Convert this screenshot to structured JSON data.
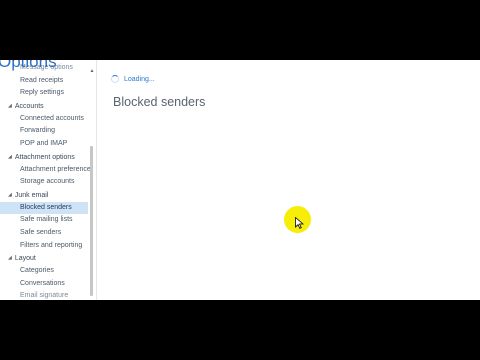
{
  "header": {
    "title": "Options"
  },
  "sidebar": {
    "items": [
      {
        "label": "Message options",
        "kind": "sub",
        "state": "cut"
      },
      {
        "label": "Read receipts",
        "kind": "sub"
      },
      {
        "label": "Reply settings",
        "kind": "sub"
      },
      {
        "label": "Accounts",
        "kind": "group"
      },
      {
        "label": "Connected accounts",
        "kind": "sub"
      },
      {
        "label": "Forwarding",
        "kind": "sub"
      },
      {
        "label": "POP and IMAP",
        "kind": "sub"
      },
      {
        "label": "Attachment options",
        "kind": "group"
      },
      {
        "label": "Attachment preference",
        "kind": "sub"
      },
      {
        "label": "Storage accounts",
        "kind": "sub"
      },
      {
        "label": "Junk email",
        "kind": "group"
      },
      {
        "label": "Blocked senders",
        "kind": "sub",
        "state": "selected"
      },
      {
        "label": "Safe mailing lists",
        "kind": "sub"
      },
      {
        "label": "Safe senders",
        "kind": "sub"
      },
      {
        "label": "Filters and reporting",
        "kind": "sub"
      },
      {
        "label": "Layout",
        "kind": "group"
      },
      {
        "label": "Categories",
        "kind": "sub"
      },
      {
        "label": "Conversations",
        "kind": "sub"
      },
      {
        "label": "Email signature",
        "kind": "sub",
        "state": "cut"
      }
    ],
    "group_caret_icon": "caret-down-icon"
  },
  "main": {
    "loading_text": "Loading...",
    "page_title": "Blocked senders"
  },
  "colors": {
    "accent": "#2d7bd0",
    "selected_bg": "#cfe3f7",
    "cursor_highlight": "#f6ee08",
    "letterbox": "#000000"
  }
}
